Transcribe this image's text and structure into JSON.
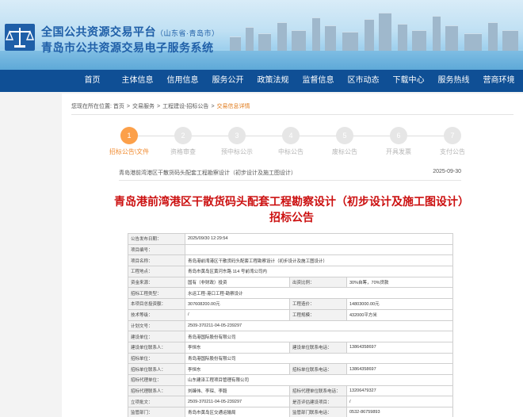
{
  "header": {
    "title_main": "全国公共资源交易平台",
    "title_region": "（山东省·青岛市）",
    "title_sub": "青岛市公共资源交易电子服务系统"
  },
  "nav": {
    "items": [
      "首页",
      "主体信息",
      "信用信息",
      "服务公开",
      "政策法规",
      "监督信息",
      "区市动态",
      "下载中心",
      "服务热线",
      "营商环境"
    ]
  },
  "breadcrumb": {
    "prefix": "您现在所在位置:",
    "items": [
      "首页",
      "交易服务",
      "工程建设-招标公告",
      "交易信息详情"
    ],
    "separator": ">"
  },
  "steps": {
    "items": [
      {
        "num": "1",
        "label": "招标公告\\文件"
      },
      {
        "num": "2",
        "label": "资格审查"
      },
      {
        "num": "3",
        "label": "预中标公示"
      },
      {
        "num": "4",
        "label": "中标公告"
      },
      {
        "num": "5",
        "label": "废标公告"
      },
      {
        "num": "6",
        "label": "开具发票"
      },
      {
        "num": "7",
        "label": "支付公告"
      }
    ],
    "active_index": 0
  },
  "project": {
    "name": "青岛港前湾港区干散货码头配套工程勘察设计（初步设计及施工图设计）",
    "date": "2025-09-30"
  },
  "document": {
    "title": "青岛港前湾港区干散货码头配套工程勘察设计（初步设计及施工图设计）招标公告"
  },
  "info_table": {
    "rows": [
      {
        "k1": "公告发布日期：",
        "v1": "2025/09/30 12:29:54"
      },
      {
        "k1": "项目编号：",
        "v1": ""
      },
      {
        "k1": "项目名称：",
        "v1": "青岛港前湾港区干散货码头配套工程勘察设计（初步设计及施工图设计）"
      },
      {
        "k1": "工程地点：",
        "v1": "青岛市黄岛区黄河东路 114 号前湾公司内"
      },
      {
        "k1": "资金来源：",
        "v1": "国有（非财政）投资",
        "k2": "出资比例：",
        "v2": "30%自筹，70%贷款"
      },
      {
        "k1": "招标工程类型：",
        "v1": "水运工程-港口工程-勘察设计"
      },
      {
        "k1": "本项目总投资额：",
        "v1": "307608200.00元",
        "k2": "工程造价：",
        "v2": "14803000.00元"
      },
      {
        "k1": "技术等级：",
        "v1": "/",
        "k2": "工程规模：",
        "v2": "432000平方米"
      },
      {
        "k1": "计划文号：",
        "v1": "2509-370211-04-05-239297"
      },
      {
        "k1": "建设单位：",
        "v1": "青岛港国际股份有限公司"
      },
      {
        "k1": "建设单位联系人：",
        "v1": "李恒东",
        "k2": "建设单位联系电话：",
        "v2": "13864358697"
      },
      {
        "k1": "招标单位：",
        "v1": "青岛港国际股份有限公司"
      },
      {
        "k1": "招标单位联系人：",
        "v1": "李恒东",
        "k2": "招标单位联系电话：",
        "v2": "13864358697"
      },
      {
        "k1": "招标代理单位：",
        "v1": "山东建泽工程项目管理有限公司"
      },
      {
        "k1": "招标代理联系人：",
        "v1": "刘臻伟、李琛、李毅",
        "k2": "招标代理单位联系电话：",
        "v2": "13206479327"
      },
      {
        "k1": "立项批文：",
        "v1": "2509-370211-04-05-239297",
        "k2": "是否评估建设项目：",
        "v2": "/"
      },
      {
        "k1": "监管部门：",
        "v1": "青岛市黄岛区交通运输局",
        "k2": "监管部门联系电话：",
        "v2": "0532-86759893"
      }
    ]
  },
  "colors": {
    "nav_bg": "#0f4f95",
    "title_red": "#cc1111",
    "step_active": "#fca04a",
    "breadcrumb_current": "#e07a1b"
  }
}
